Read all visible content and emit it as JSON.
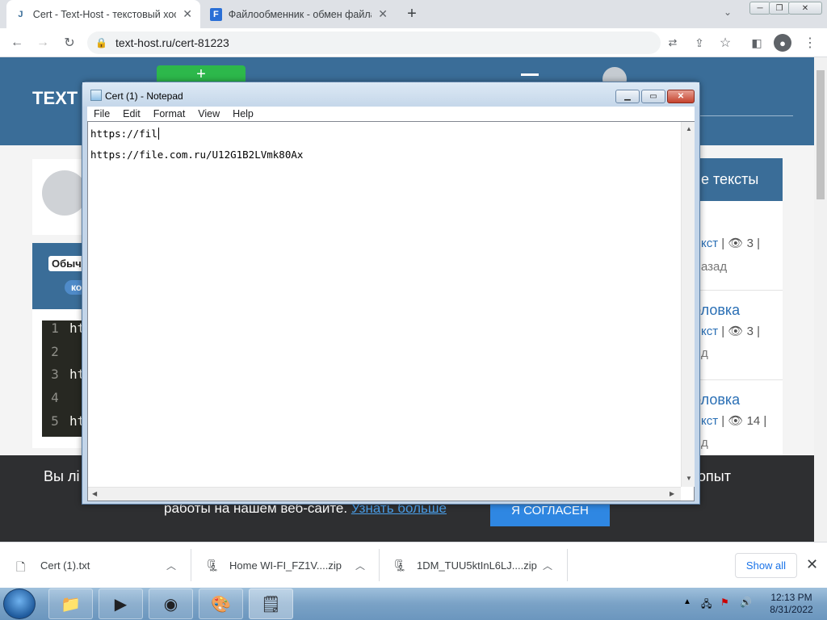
{
  "browser": {
    "tabs": [
      {
        "title": "Cert - Text-Host - текстовый хос",
        "favicon": "J",
        "active": true
      },
      {
        "title": "Файлообменник - обмен файла",
        "favicon": "F",
        "active": false
      }
    ],
    "url": "text-host.ru/cert-81223"
  },
  "site": {
    "logo": "TEXT",
    "plain_label": "Обыч",
    "copy_chip": "ко",
    "code_lines": [
      {
        "num": "1",
        "text": "ht"
      },
      {
        "num": "2",
        "text": ""
      },
      {
        "num": "3",
        "text": "ht"
      },
      {
        "num": "4",
        "text": ""
      },
      {
        "num": "5",
        "text": "ht"
      }
    ],
    "right_panel": {
      "header": "е тексты",
      "items": [
        {
          "title": "",
          "meta_link": "кст",
          "views": "3",
          "when": "азад"
        },
        {
          "title": "оловка",
          "meta_link": "кст",
          "views": "3",
          "when": "д"
        },
        {
          "title": "оловка",
          "meta_link": "кст",
          "views": "14",
          "when": "д"
        }
      ]
    },
    "cookie": {
      "line1_left": "Вы лі",
      "line1_right": "опыт",
      "line2": "работы на нашем веб-сайте.",
      "more_link": "Узнать больше",
      "agree_button": "Я СОГЛАСЕН"
    }
  },
  "notepad": {
    "title": "Cert (1) - Notepad",
    "menu": [
      "File",
      "Edit",
      "Format",
      "View",
      "Help"
    ],
    "line1": "https://fil",
    "line2": "https://file.com.ru/U12G1B2LVmk80Ax"
  },
  "downloads": {
    "items": [
      {
        "name": "Cert (1).txt",
        "icon": "text-file-icon"
      },
      {
        "name": "Home WI-FI_FZ1V....zip",
        "icon": "zip-file-icon"
      },
      {
        "name": "1DM_TUU5ktInL6LJ....zip",
        "icon": "zip-file-icon"
      }
    ],
    "show_all": "Show all"
  },
  "taskbar": {
    "time": "12:13 PM",
    "date": "8/31/2022"
  }
}
